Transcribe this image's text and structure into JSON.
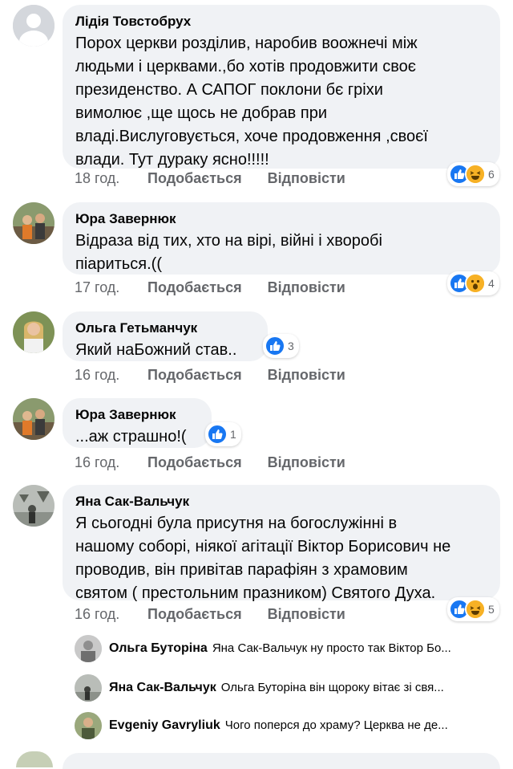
{
  "comments": [
    {
      "author": "Лідія Товстобрух",
      "lines": [
        "Порох церкви розділив, наробив воожнечі між",
        "людьми і церквами.,бо хотів продовжити своє",
        "президенство. А САПОГ поклони бє гріхи",
        "вимолює  ,ще щось не добрав при",
        "владі.Вислуговується, хоче продовження ,своєї",
        "влади. Тут дураку ясно!!!!!"
      ],
      "time": "18 год.",
      "like": "Подобається",
      "reply": "Відповісти",
      "reactions": [
        "like",
        "haha"
      ],
      "count": "6"
    },
    {
      "author": "Юра Заверню­к",
      "lines": [
        "Відраза від тих, хто на вірі, війні і хворобі",
        "піариться.(("
      ],
      "time": "17 год.",
      "like": "Подобається",
      "reply": "Відповісти",
      "reactions": [
        "like",
        "wow"
      ],
      "count": "4"
    },
    {
      "author": "Ольга Гетьманчук",
      "lines": [
        "Який наБожний став.."
      ],
      "time": "16 год.",
      "like": "Подобається",
      "reply": "Відповісти",
      "reactions": [
        "like"
      ],
      "count": "3"
    },
    {
      "author": "Юра Заверню­к",
      "lines": [
        "...аж страшно!("
      ],
      "time": "16 год.",
      "like": "Подобається",
      "reply": "Відповісти",
      "reactions": [
        "like"
      ],
      "count": "1"
    },
    {
      "author": "Яна Сак-Вальчук",
      "lines": [
        "Я сьогодні була присутня на богослужінні в",
        "нашому соборі, ніякої агітації Віктор Борисович не",
        "проводив, він привітав парафіян з храмовим",
        "святом ( престольним празником)  Святого Духа."
      ],
      "time": "16 год.",
      "like": "Подобається",
      "reply": "Відповісти",
      "reactions": [
        "like",
        "haha"
      ],
      "count": "5"
    }
  ],
  "replies": [
    {
      "author": "Ольга Буторіна",
      "text": "Яна Сак-Вальчук ну просто так Віктор Бо..."
    },
    {
      "author": "Яна Сак-Вальчук",
      "text": "Ольга Буторіна він щороку вітає зі свя..."
    },
    {
      "author": "Evgeniy  Gavryliuk",
      "text": "Чого поперся до храму? Церква не де..."
    }
  ],
  "colors": {
    "bubble": "#f0f2f5",
    "meta": "#65676b",
    "like_blue": "#1877f2",
    "emoji_yellow": "#f7b125"
  }
}
